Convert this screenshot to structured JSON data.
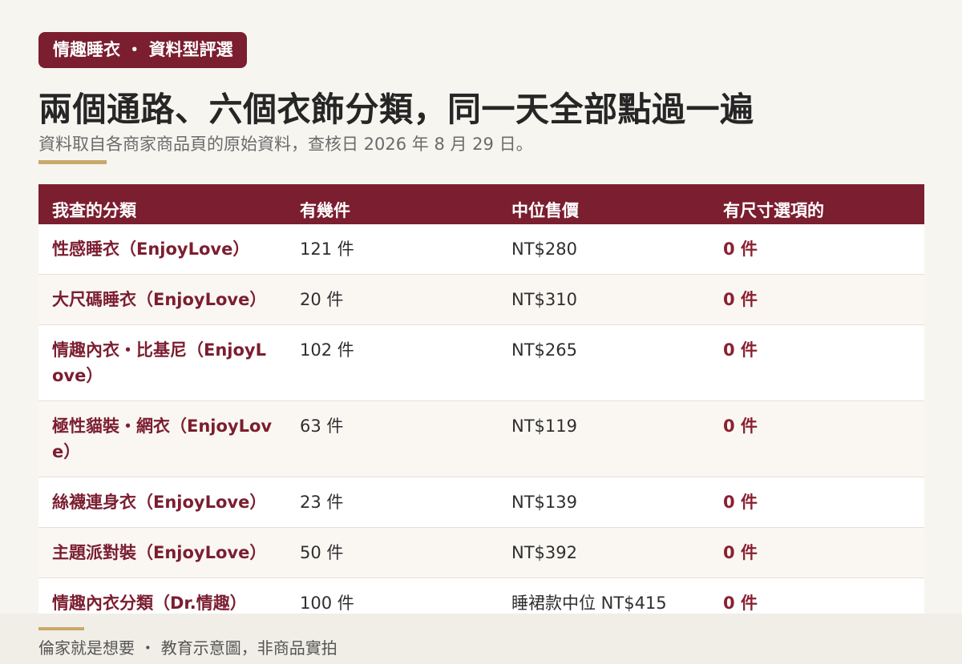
{
  "badge": "情趣睡衣 ・ 資料型評選",
  "title": "兩個通路、六個衣飾分類，同一天全部點過一遍",
  "subtitle": "資料取自各商家商品頁的原始資料，查核日 2026 年 8 月 29 日。",
  "table": {
    "headers": [
      "我查的分類",
      "有幾件",
      "中位售價",
      "有尺寸選項的"
    ],
    "rows": [
      {
        "category": "性感睡衣（EnjoyLove）",
        "count": "121 件",
        "median_price": "NT$280",
        "size_options": "0 件"
      },
      {
        "category": "大尺碼睡衣（EnjoyLove）",
        "count": "20 件",
        "median_price": "NT$310",
        "size_options": "0 件"
      },
      {
        "category": "情趣內衣・比基尼（EnjoyLove）",
        "count": "102 件",
        "median_price": "NT$265",
        "size_options": "0 件"
      },
      {
        "category": "極性貓裝・網衣（EnjoyLove）",
        "count": "63 件",
        "median_price": "NT$119",
        "size_options": "0 件"
      },
      {
        "category": "絲襪連身衣（EnjoyLove）",
        "count": "23 件",
        "median_price": "NT$139",
        "size_options": "0 件"
      },
      {
        "category": "主題派對裝（EnjoyLove）",
        "count": "50 件",
        "median_price": "NT$392",
        "size_options": "0 件"
      },
      {
        "category": "情趣內衣分類（Dr.情趣）",
        "count": "100 件",
        "median_price": "睡裙款中位 NT$415",
        "size_options": "0 件"
      }
    ]
  },
  "footer": "倫家就是想要 ・ 教育示意圖，非商品實拍",
  "colors": {
    "accent": "#7b1e30",
    "gold": "#c8a96a",
    "background": "#f7f5f0"
  }
}
